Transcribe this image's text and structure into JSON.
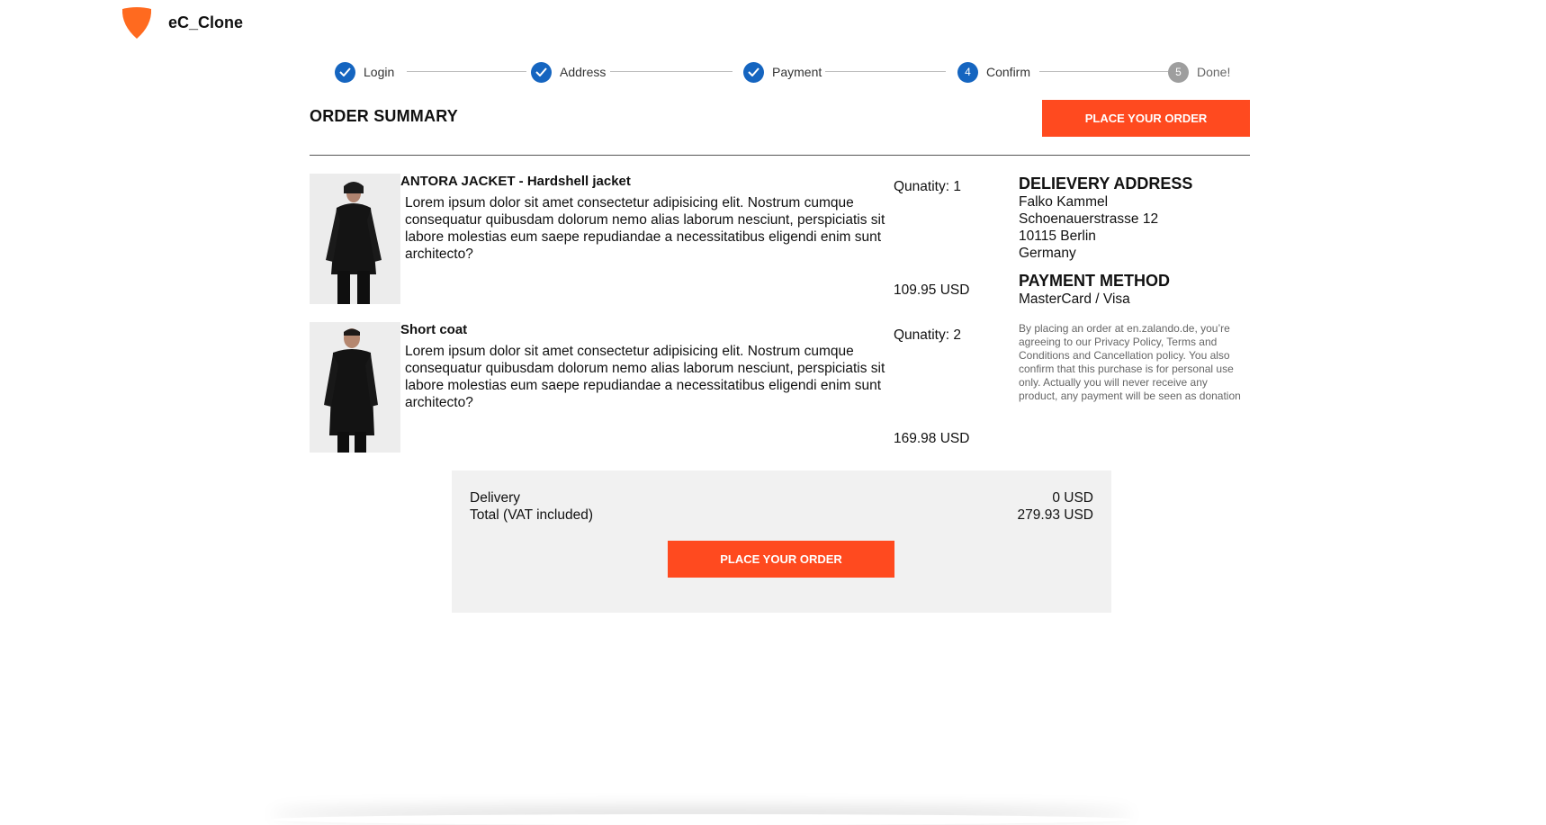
{
  "app": {
    "brand": "eC_Clone"
  },
  "steps": [
    {
      "number": "1",
      "label": "Login",
      "state": "done"
    },
    {
      "number": "2",
      "label": "Address",
      "state": "done"
    },
    {
      "number": "3",
      "label": "Payment",
      "state": "done"
    },
    {
      "number": "4",
      "label": "Confirm",
      "state": "active"
    },
    {
      "number": "5",
      "label": "Done!",
      "state": "pending"
    }
  ],
  "summary": {
    "title": "ORDER SUMMARY",
    "place_order_label": "PLACE YOUR ORDER"
  },
  "items": [
    {
      "name": "ANTORA JACKET - Hardshell jacket",
      "description": "Lorem ipsum dolor sit amet consectetur adipisicing elit. Nostrum cumque consequatur quibusdam dolorum nemo alias laborum nesciunt, perspiciatis sit labore molestias eum saepe repudiandae a necessitatibus eligendi enim sunt architecto?",
      "quantity": "Qunatity: 1",
      "price": "109.95 USD"
    },
    {
      "name": "Short coat",
      "description": "Lorem ipsum dolor sit amet consectetur adipisicing elit. Nostrum cumque consequatur quibusdam dolorum nemo alias laborum nesciunt, perspiciatis sit labore molestias eum saepe repudiandae a necessitatibus eligendi enim sunt architecto?",
      "quantity": "Qunatity: 2",
      "price": "169.98 USD"
    }
  ],
  "address": {
    "title": "DELIEVERY ADDRESS",
    "name": "Falko Kammel",
    "street": "Schoenauerstrasse 12",
    "city": "10115 Berlin",
    "country": "Germany"
  },
  "payment": {
    "title": "PAYMENT METHOD",
    "method": "MasterCard / Visa"
  },
  "legal": "By placing an order at en.zalando.de, you’re agreeing to our Privacy Policy, Terms and Conditions and Cancellation policy. You also confirm that this purchase is for personal use only. Actually you will never receive any product, any payment will be seen as donation",
  "totals": {
    "delivery_label": "Delivery",
    "delivery_value": "0 USD",
    "total_label": "Total (VAT included)",
    "total_value": "279.93 USD",
    "place_order_label": "PLACE YOUR ORDER"
  },
  "colors": {
    "accent": "#ff4a1f",
    "logo": "#ff6a1f",
    "step": "#1565c0",
    "step_pending": "#9e9e9e",
    "totals_bg": "#f1f1f1"
  }
}
